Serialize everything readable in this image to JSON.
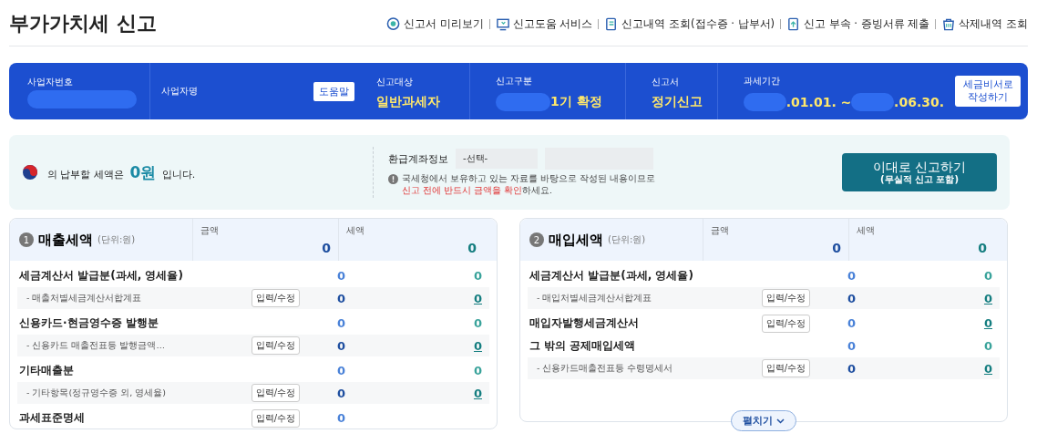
{
  "page_title": "부가가치세 신고",
  "header_links": [
    {
      "label": "신고서 미리보기"
    },
    {
      "label": "신고도움 서비스"
    },
    {
      "label": "신고내역 조회(접수증 · 납부서)"
    },
    {
      "label": "신고 부속 · 증빙서류 제출"
    },
    {
      "label": "삭제내역 조회"
    }
  ],
  "info_bar": {
    "business_number_label": "사업자번호",
    "business_name_label": "사업자명",
    "help_button": "도움말",
    "fields": [
      {
        "label": "신고대상",
        "value": "일반과세자",
        "redacted": false
      },
      {
        "label": "신고구분",
        "value": "1기 확정",
        "redacted": true
      },
      {
        "label": "신고서",
        "value": "정기신고",
        "redacted": false
      },
      {
        "label": "과세기간",
        "value_parts": [
          ".01.01. ~",
          ".06.30."
        ],
        "redacted": true
      }
    ],
    "tax_accountant_button": "세금비서로 작성하기"
  },
  "summary": {
    "prefix": "의 납부할 세액은",
    "amount": "0원",
    "suffix": "입니다.",
    "refund_label": "환급계좌정보",
    "refund_select": "-선택-",
    "notice": "국세청에서 보유하고 있는 자료를 바탕으로 작성된 내용이므로",
    "warning": "신고 전에 반드시 금액을 확인",
    "warning_suffix": "하세요.",
    "submit_button": "이대로 신고하기",
    "submit_sub": "(무실적 신고 포함)"
  },
  "panels": [
    {
      "number": "1",
      "title": "매출세액",
      "unit": "(단위:원)",
      "amount_label": "금액",
      "tax_label": "세액",
      "total_amount": "0",
      "total_tax": "0",
      "rows": [
        {
          "kind": "main",
          "label": "세금계산서 발급분(과세, 영세율)",
          "amount": "0",
          "tax": "0"
        },
        {
          "kind": "sub",
          "label": "- 매출처별세금계산서합계표",
          "button": "입력/수정",
          "amount": "0",
          "tax": "0"
        },
        {
          "kind": "main",
          "label": "신용카드·현금영수증 발행분",
          "amount": "0",
          "tax": "0"
        },
        {
          "kind": "sub",
          "label": "- 신용카드 매출전표등 발행금액…",
          "button": "입력/수정",
          "amount": "0",
          "tax": "0"
        },
        {
          "kind": "main",
          "label": "기타매출분",
          "amount": "0",
          "tax": "0"
        },
        {
          "kind": "sub",
          "label": "- 기타항목(정규영수증 외, 영세율)",
          "button": "입력/수정",
          "amount": "0",
          "tax": "0"
        },
        {
          "kind": "mainbtn",
          "label": "과세표준명세",
          "button": "입력/수정",
          "amount": "0"
        }
      ]
    },
    {
      "number": "2",
      "title": "매입세액",
      "unit": "(단위:원)",
      "amount_label": "금액",
      "tax_label": "세액",
      "total_amount": "0",
      "total_tax": "0",
      "expand_button": "펼치기",
      "rows": [
        {
          "kind": "main",
          "label": "세금계산서 발급분(과세, 영세율)",
          "amount": "0",
          "tax": "0"
        },
        {
          "kind": "sub",
          "label": "- 매입처별세금계산서합계표",
          "button": "입력/수정",
          "amount": "0",
          "tax": "0"
        },
        {
          "kind": "mainbtn",
          "label": "매입자발행세금계산서",
          "button": "입력/수정",
          "amount": "0",
          "tax": "0"
        },
        {
          "kind": "main",
          "label": "그 밖의 공제매입세액",
          "amount": "0",
          "tax": "0"
        },
        {
          "kind": "sub",
          "label": "- 신용카드매출전표등 수령명세서",
          "button": "입력/수정",
          "amount": "0",
          "tax": "0"
        }
      ]
    }
  ]
}
